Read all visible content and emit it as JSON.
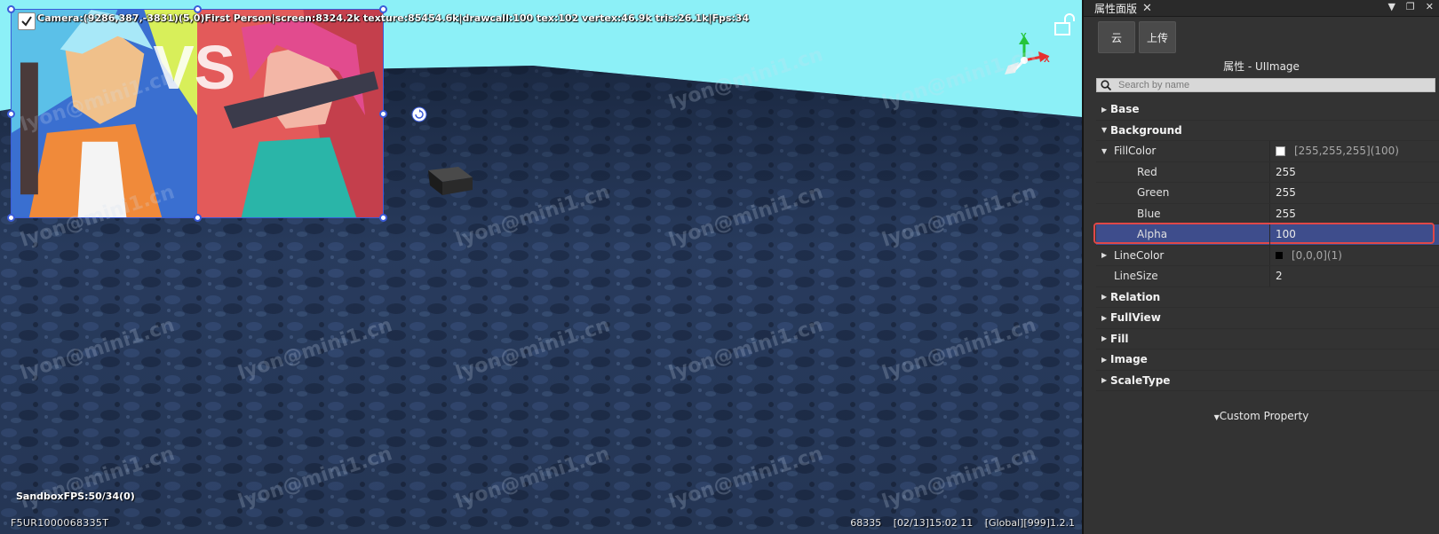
{
  "viewport": {
    "stats": "Camera:(9286,387,-3831)(5,0)First Person|screen:8324.2k texture:85454.6k|drawcall:100 tex:102 vertex:46.9k tris:26.1k|Fps:34",
    "sandbox_fps": "SandboxFPS:50/34(0)",
    "device_id": "F5UR1000068335T",
    "footer": {
      "code": "68335",
      "datetime": "[02/13]15:02 11",
      "scope": "[Global][999]1.2.1"
    },
    "watermark": "lyon@mini1.cn",
    "colors": {
      "sky": "#8cf0f7",
      "ground": "#2b3f63",
      "selection": "#3b5bd9"
    },
    "gizmo_axes": {
      "x": "X",
      "y": "Y"
    }
  },
  "panel": {
    "tab_title": "属性面版",
    "buttons": {
      "cloud": "云",
      "upload": "上传"
    },
    "subtitle": "属性 - UIImage",
    "search_placeholder": "Search by name",
    "sections": {
      "base": "Base",
      "background": "Background",
      "relation": "Relation",
      "fullview": "FullView",
      "fill": "Fill",
      "image": "Image",
      "scaletype": "ScaleType"
    },
    "fillcolor": {
      "label": "FillColor",
      "value": "[255,255,255](100)",
      "red_label": "Red",
      "red": "255",
      "green_label": "Green",
      "green": "255",
      "blue_label": "Blue",
      "blue": "255",
      "alpha_label": "Alpha",
      "alpha": "100"
    },
    "linecolor": {
      "label": "LineColor",
      "value": "[0,0,0](1)"
    },
    "linesize": {
      "label": "LineSize",
      "value": "2"
    },
    "custom_property": "Custom Property"
  }
}
